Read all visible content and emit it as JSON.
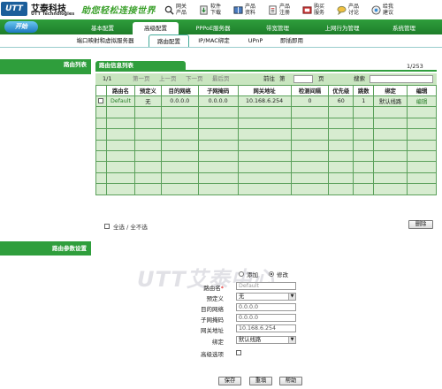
{
  "header": {
    "logo": "UTT",
    "brand_cn": "艾泰科技",
    "brand_en": "UTT Technologies",
    "slogan": "助您轻松连接世界",
    "topnav": [
      {
        "label": "网关产品",
        "icon": "search-icon"
      },
      {
        "label": "软件下载",
        "icon": "download-icon"
      },
      {
        "label": "产品资料",
        "icon": "book-icon"
      },
      {
        "label": "产品注册",
        "icon": "register-icon"
      },
      {
        "label": "购买服务",
        "icon": "cart-icon"
      },
      {
        "label": "产品讨论",
        "icon": "chat-icon"
      },
      {
        "label": "给我建议",
        "icon": "suggest-icon"
      }
    ]
  },
  "nav": {
    "start": "开始",
    "main_tabs": [
      "基本配置",
      "高级配置",
      "PPPoE服务器",
      "带宽管理",
      "上网行为管理",
      "系统管理"
    ],
    "active_main": 1,
    "sub_tabs": [
      "端口映射和虚拟服务器",
      "路由配置",
      "IP/MAC绑定",
      "UPnP",
      "即插即用"
    ],
    "active_sub": 1
  },
  "sidebar": {
    "route_list": "路由列表",
    "route_params": "路由参数设置"
  },
  "table": {
    "title": "路由信息列表",
    "count": "1/253",
    "pager": {
      "page": "1/1",
      "first": "第一页",
      "prev": "上一页",
      "next": "下一页",
      "last": "最后页",
      "goto": "前往",
      "nth": "第",
      "page_unit": "页",
      "search": "搜索"
    },
    "columns": [
      "",
      "路由名",
      "预定义",
      "目的网络",
      "子网掩码",
      "网关地址",
      "检测间隔",
      "优先级",
      "跳数",
      "绑定",
      "编辑"
    ],
    "rows": [
      {
        "name": "Default",
        "predef": "无",
        "dest": "0.0.0.0",
        "mask": "0.0.0.0",
        "gateway": "10.168.6.254",
        "interval": "0",
        "priority": "60",
        "hops": "1",
        "bind": "默认线路",
        "edit": "编辑"
      }
    ],
    "select_all": "全选 / 全不选",
    "delete": "删除"
  },
  "form": {
    "add": "添加",
    "edit": "修改",
    "watermark": "UTT艾泰中心",
    "route_name_label": "路由名",
    "route_name_value": "Default",
    "predef_label": "预定义",
    "predef_value": "无",
    "dest_label": "目的网络",
    "dest_value": "0.0.0.0",
    "mask_label": "子网掩码",
    "mask_value": "0.0.0.0",
    "gateway_label": "网关地址",
    "gateway_value": "10.168.6.254",
    "bind_label": "绑定",
    "bind_value": "默认线路",
    "advanced_label": "高级选项",
    "save": "保存",
    "reset": "重填",
    "help": "帮助"
  },
  "colors": {
    "green": "#2f9e3c",
    "row": "#d7ecd0",
    "pager": "#c9e5c0",
    "link": "#2a7f2a"
  }
}
